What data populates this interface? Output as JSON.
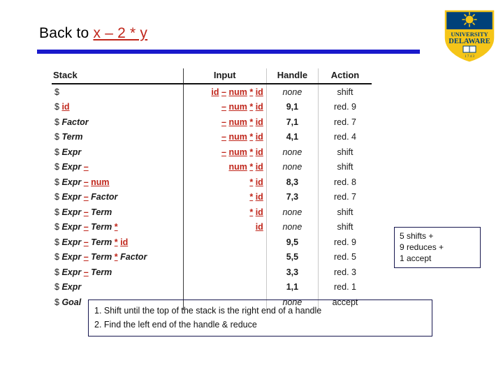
{
  "slide": {
    "title_prefix": "Back to ",
    "title_expression": "x – 2 * y",
    "accent_blue": "#1A1ACC",
    "terminal_red": "#C0261B",
    "box_border": "#17174F"
  },
  "logo": {
    "name": "university-of-delaware-shield",
    "line1": "UNIVERSITY OF",
    "line2": "DELAWARE",
    "year": "1743"
  },
  "table": {
    "headers": {
      "stack": "Stack",
      "input": "Input",
      "handle": "Handle",
      "action": "Action"
    },
    "rows": [
      {
        "stack": "$",
        "input": "id – num * id",
        "handle": "none",
        "action": "shift"
      },
      {
        "stack": "$ id",
        "input": "– num * id",
        "handle": "9,1",
        "action": "red. 9"
      },
      {
        "stack": "$ Factor",
        "input": "– num * id",
        "handle": "7,1",
        "action": "red. 7"
      },
      {
        "stack": "$ Term",
        "input": "– num * id",
        "handle": "4,1",
        "action": "red. 4"
      },
      {
        "stack": "$ Expr",
        "input": "– num * id",
        "handle": "none",
        "action": "shift"
      },
      {
        "stack": "$ Expr –",
        "input": "num * id",
        "handle": "none",
        "action": "shift"
      },
      {
        "stack": "$ Expr – num",
        "input": "* id",
        "handle": "8,3",
        "action": "red. 8"
      },
      {
        "stack": "$ Expr – Factor",
        "input": "* id",
        "handle": "7,3",
        "action": "red. 7"
      },
      {
        "stack": "$ Expr – Term",
        "input": "* id",
        "handle": "none",
        "action": "shift"
      },
      {
        "stack": "$ Expr – Term *",
        "input": "id",
        "handle": "none",
        "action": "shift"
      },
      {
        "stack": "$ Expr – Term * id",
        "input": "",
        "handle": "9,5",
        "action": "red. 9"
      },
      {
        "stack": "$ Expr – Term * Factor",
        "input": "",
        "handle": "5,5",
        "action": "red. 5"
      },
      {
        "stack": "$ Expr – Term",
        "input": "",
        "handle": "3,3",
        "action": "red. 3"
      },
      {
        "stack": "$ Expr",
        "input": "",
        "handle": "1,1",
        "action": "red. 1"
      },
      {
        "stack": "$ Goal",
        "input": "",
        "handle": "none",
        "action": "accept"
      }
    ]
  },
  "summary": {
    "line1": "5 shifts +",
    "line2": "9 reduces +",
    "line3": "1 accept"
  },
  "notes": {
    "line1": "1. Shift until the top of the stack is the right end of a handle",
    "line2": "2. Find the left end of the handle & reduce"
  }
}
